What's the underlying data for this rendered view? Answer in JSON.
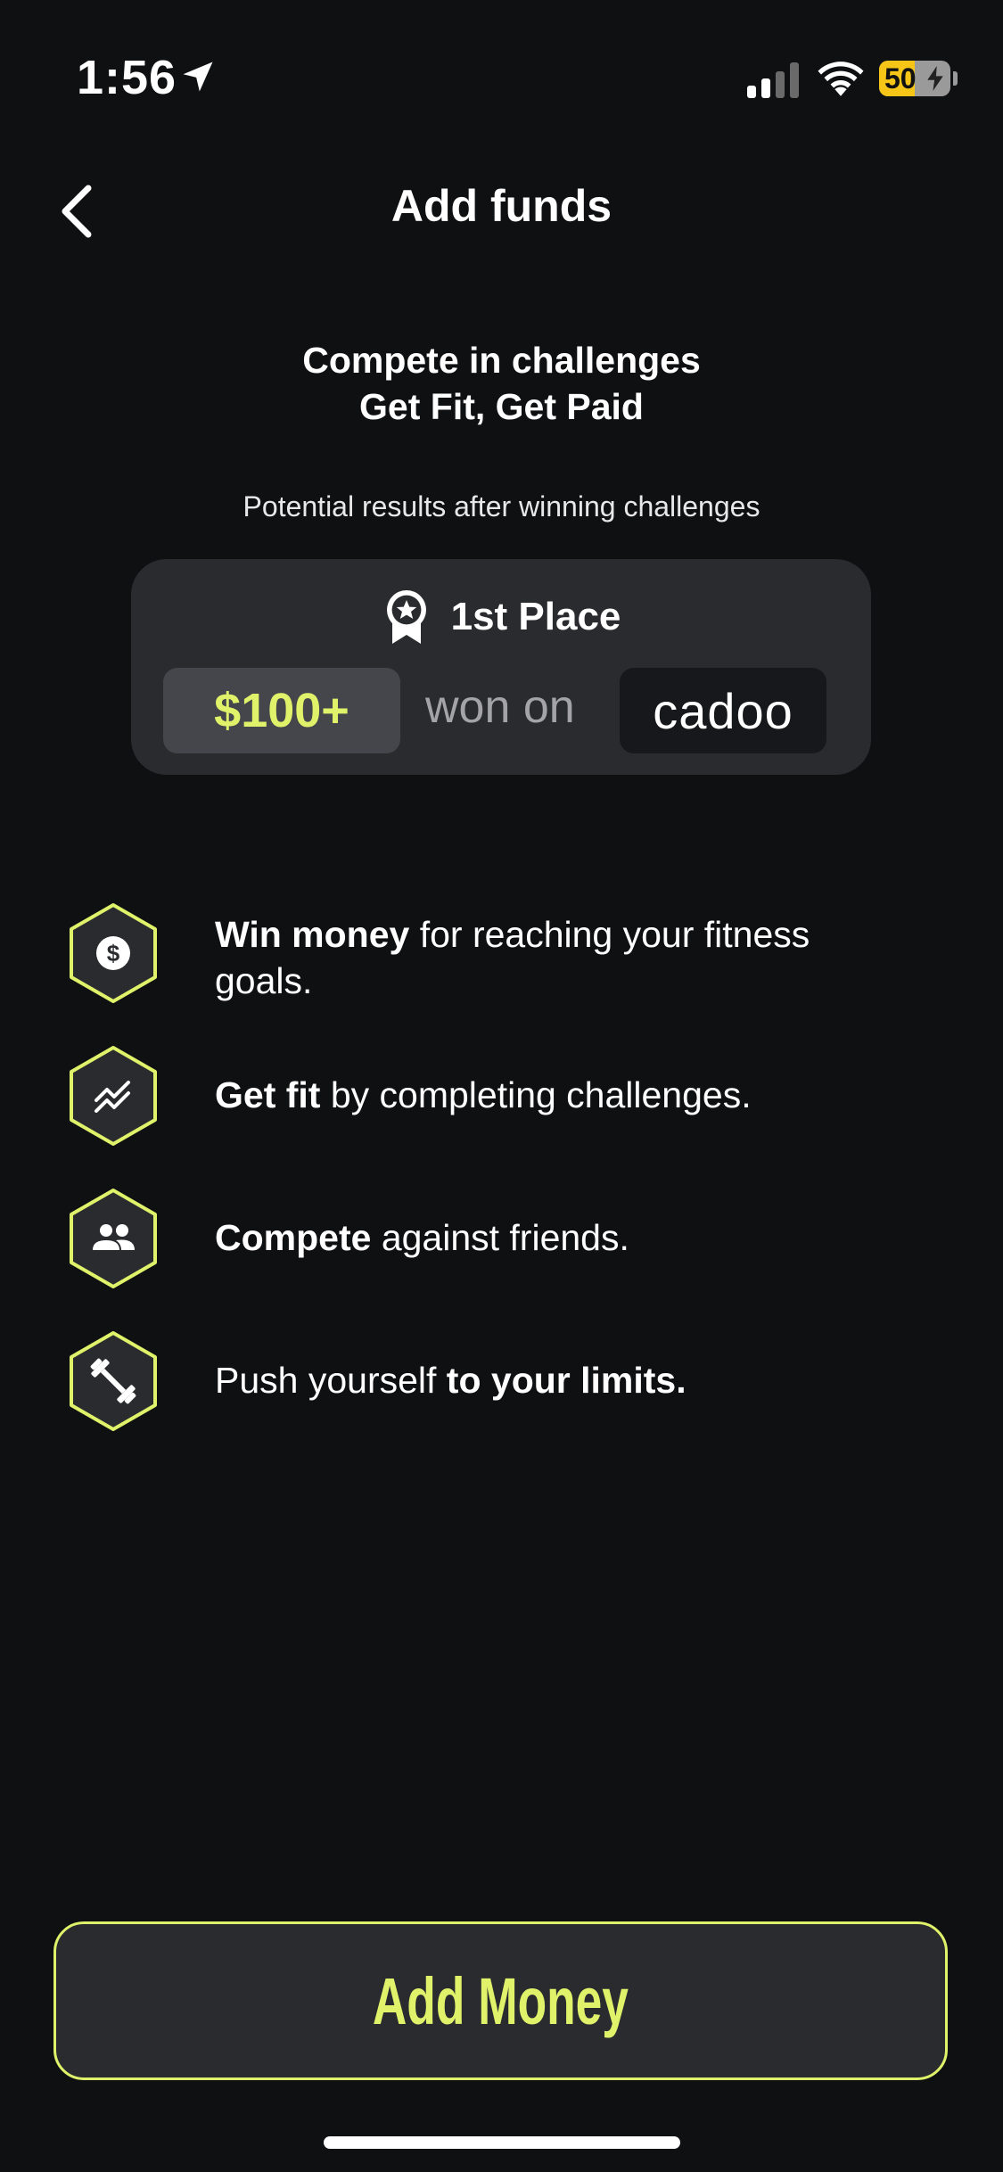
{
  "status_bar": {
    "time": "1:56",
    "battery": "50",
    "battery_level": 0.5,
    "icons": [
      "location-arrow-icon",
      "signal-icon",
      "wifi-icon",
      "battery-icon"
    ]
  },
  "nav": {
    "title": "Add funds",
    "back_icon": "chevron-left-icon"
  },
  "headline": {
    "line1": "Compete in challenges",
    "line2": "Get Fit, Get Paid"
  },
  "caption": "Potential results after winning challenges",
  "result_card": {
    "place_icon": "ribbon-star-icon",
    "place_label": "1st Place",
    "prize": "$100+",
    "won_on": "won on",
    "brand": "cadoo"
  },
  "features": [
    {
      "icon": "dollar-icon",
      "bold": "Win money",
      "rest": " for reaching your fitness goals."
    },
    {
      "icon": "trend-icon",
      "bold": "Get fit",
      "rest": " by completing challenges."
    },
    {
      "icon": "people-icon",
      "bold": "Compete",
      "rest": " against friends."
    },
    {
      "icon": "dumbbell-icon",
      "prefix": "Push yourself ",
      "bold": "to your limits."
    }
  ],
  "cta": {
    "label": "Add Money"
  },
  "colors": {
    "background": "#0f1012",
    "accent": "#dff26a",
    "card": "#2a2b2f",
    "prize_badge": "#45464b",
    "brand_badge": "#17181b",
    "muted_text": "#a4a4a8",
    "battery": "#f5c518"
  }
}
